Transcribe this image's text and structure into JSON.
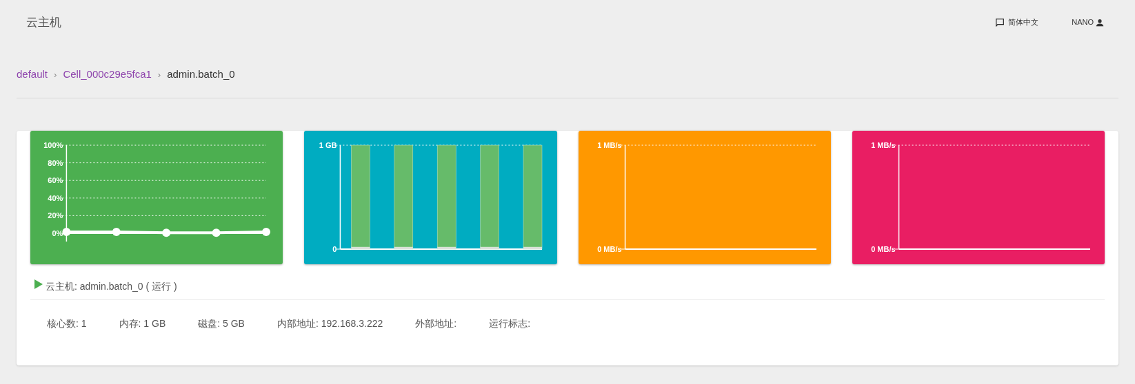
{
  "header": {
    "title": "云主机",
    "language": "简体中文",
    "user": "NANO"
  },
  "breadcrumb_separator": "›",
  "breadcrumb": [
    {
      "label": "default",
      "kind": "link"
    },
    {
      "label": "Cell_000c29e5fca1",
      "kind": "link"
    },
    {
      "label": "admin.batch_0",
      "kind": "current"
    }
  ],
  "monitors": [
    {
      "color": "#4caf50",
      "chart_data": {
        "type": "line",
        "grid": true,
        "ylim": [
          0,
          100
        ],
        "yticks": [
          {
            "value": 0,
            "label": "0%"
          },
          {
            "value": 20,
            "label": "20%"
          },
          {
            "value": 40,
            "label": "40%"
          },
          {
            "value": 60,
            "label": "60%"
          },
          {
            "value": 80,
            "label": "80%"
          },
          {
            "value": 100,
            "label": "100%"
          }
        ],
        "series": [
          {
            "color": "#ffffff",
            "marker": "circle",
            "values": [
              1.5,
              1.5,
              0.5,
              0.5,
              1.5
            ]
          }
        ]
      }
    },
    {
      "color": "#00acc1",
      "chart_data": {
        "type": "bar",
        "grid": true,
        "stacked": true,
        "ylim": [
          0,
          1
        ],
        "yticks": [
          {
            "value": 0,
            "label": "0"
          },
          {
            "value": 1,
            "label": "1 GB"
          }
        ],
        "series": [
          {
            "color": "#e0e0e0",
            "values": [
              0.02,
              0.02,
              0.02,
              0.02,
              0.02
            ]
          },
          {
            "color": "#66bb6a",
            "values": [
              0.98,
              0.98,
              0.98,
              0.98,
              0.98
            ]
          }
        ]
      }
    },
    {
      "color": "#ff9800",
      "axis_labels": [
        "1 MB/s",
        "0 MB/s"
      ],
      "chart_data": {
        "type": "other"
      }
    },
    {
      "color": "#e91e63",
      "axis_labels": [
        "1 MB/s",
        "0 MB/s"
      ],
      "chart_data": {
        "type": "other"
      }
    }
  ],
  "instance": {
    "title": "云主机: admin.batch_0 ( 运行 )"
  },
  "specs": [
    "核心数: 1",
    "内存: 1 GB",
    "磁盘: 5 GB",
    "内部地址: 192.168.3.222",
    "外部地址:",
    "运行标志:"
  ]
}
